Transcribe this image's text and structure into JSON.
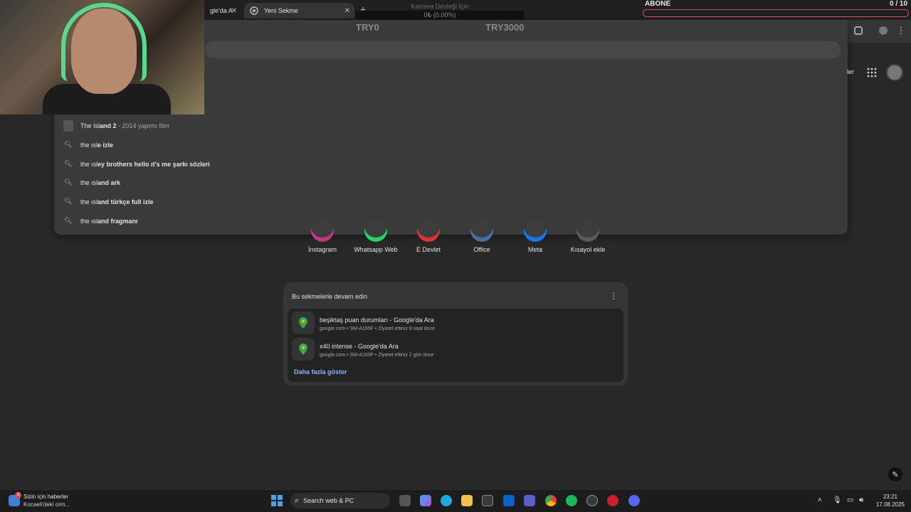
{
  "tabs": [
    {
      "label": "gle'da A",
      "active": false
    },
    {
      "label": "Yeni Sekme",
      "active": true
    }
  ],
  "new_tab_icon": "plus-icon",
  "overlay": {
    "camera_label": "Kamera Desteği İçin",
    "progress_text": "0₺ (0.00%)",
    "goal_min": "TRY0",
    "goal_max": "TRY3000",
    "subscribe_label": "ABONE",
    "subscribe_count": "0 / 10"
  },
  "suggestions": [
    {
      "icon": "film-thumb",
      "plain": "The Isl",
      "bold": "and 2",
      "sub": " - 2014 yapımı film"
    },
    {
      "icon": "search-icon",
      "plain": "the ısl",
      "bold": "e izle",
      "sub": ""
    },
    {
      "icon": "search-icon",
      "plain": "the ısl",
      "bold": "ey brothers hello ıt's me şarkı sözleri",
      "sub": ""
    },
    {
      "icon": "search-icon",
      "plain": "the ısl",
      "bold": "and ark",
      "sub": ""
    },
    {
      "icon": "search-icon",
      "plain": "the ısl",
      "bold": "and türkçe full izle",
      "sub": ""
    },
    {
      "icon": "search-icon",
      "plain": "the ısl",
      "bold": "and fragmanı",
      "sub": ""
    }
  ],
  "header_right": {
    "partial_label": "ler"
  },
  "shortcuts": [
    {
      "label": "İnstagram",
      "color": "#c13584"
    },
    {
      "label": "Whatsapp Web",
      "color": "#25d366"
    },
    {
      "label": "E Devlet",
      "color": "#d33"
    },
    {
      "label": "Office",
      "color": "#4a6fa5"
    },
    {
      "label": "Meta",
      "color": "#1877f2"
    },
    {
      "label": "Kısayol ekle",
      "color": "#5a5a5a"
    }
  ],
  "continue_card": {
    "title": "Bu sekmelerle devam edin",
    "items": [
      {
        "title": "beşiktaş puan durumları - Google'da Ara",
        "meta": "google.com • SM-A165F • Ziyaret ettiniz 8 saat önce"
      },
      {
        "title": "x40 intense - Google'da Ara",
        "meta": "google.com • SM-A165F • Ziyaret ettiniz 2 gün önce"
      }
    ],
    "more_label": "Daha fazla göster"
  },
  "taskbar": {
    "news_title": "Sizin için haberler",
    "news_sub": "Kocaeli'deki orm...",
    "news_badge": "3",
    "search_label": "Search web & PC",
    "time": "23:21",
    "date": "17.08.2025"
  },
  "colors": {
    "accent": "#8ab4f8",
    "background": "#282828",
    "abone_border": "#e04a5a"
  }
}
